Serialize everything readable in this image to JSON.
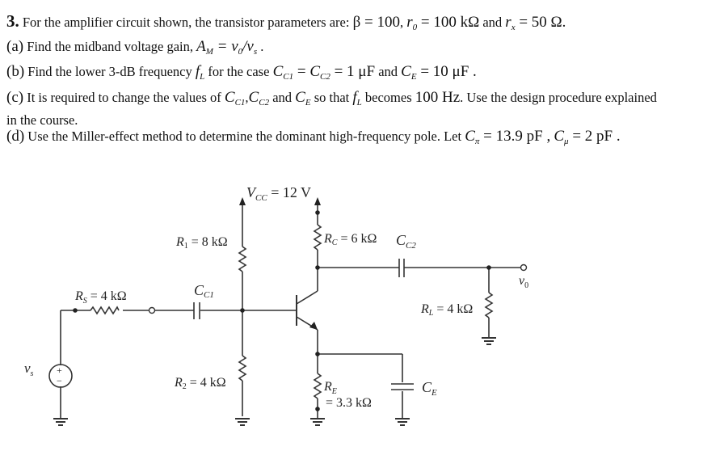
{
  "problem": {
    "number": "3.",
    "intro": "For the amplifier circuit shown, the transistor parameters are:",
    "params": {
      "beta": "β = 100",
      "ro_sym": "r",
      "ro_sub": "0",
      "ro_val": " = 100 kΩ",
      "and": "and",
      "rx_sym": "r",
      "rx_sub": "x",
      "rx_val": " = 50 Ω."
    },
    "parts": {
      "a": {
        "label": "(a)",
        "text": "Find the midband voltage gain,",
        "math_sym": "A",
        "math_sub": "M",
        "math_rest": " = v",
        "v0_sub": "0",
        "slash": "/v",
        "vs_sub": "s",
        "end": " ."
      },
      "b": {
        "label": "(b)",
        "text": "Find the lower 3-dB frequency",
        "fl_sym": "f",
        "fl_sub": "L",
        "text2": "for the case",
        "cc1_sym": "C",
        "cc1_sub": "C1",
        "eq": " = ",
        "cc2_sym": "C",
        "cc2_sub": "C2",
        "val": " = 1 μF",
        "and": "and",
        "ce_sym": "C",
        "ce_sub": "E",
        "ce_val": " = 10 μF ."
      },
      "c": {
        "label": "(c)",
        "text": "It is required to change the values of",
        "c1_sym": "C",
        "c1_sub": "C1",
        "comma": ",",
        "c2_sym": "C",
        "c2_sub": "C2",
        "and": "and",
        "ce_sym": "C",
        "ce_sub": "E",
        "text2": "so that",
        "fl_sym": "f",
        "fl_sub": "L",
        "text3": "becomes",
        "freq": "100 Hz",
        "text4": ". Use the design procedure explained",
        "cont": "in the course."
      },
      "d": {
        "label": "(d)",
        "text": "Use the Miller-effect method to determine the dominant high-frequency pole. Let",
        "cpi_sym": "C",
        "cpi_sub": "π",
        "cpi_val": " = 13.9 pF ,",
        "cmu_sym": "C",
        "cmu_sub": "μ",
        "cmu_val": " = 2  pF ."
      }
    }
  },
  "circuit": {
    "vcc": "V",
    "vcc_sub": "CC",
    "vcc_val": " = 12  V",
    "r1": "R",
    "r1_sub": "1",
    "r1_val": " = 8  kΩ",
    "rc": "R",
    "rc_sub": "C",
    "rc_val": " = 6  kΩ",
    "cc2": "C",
    "cc2_sub": "C2",
    "vo": "v",
    "vo_sub": "0",
    "rs": "R",
    "rs_sub": "S",
    "rs_val": " = 4  kΩ",
    "cc1": "C",
    "cc1_sub": "C1",
    "rl": "R",
    "rl_sub": "L",
    "rl_val": " = 4  kΩ",
    "vs": "v",
    "vs_sub": "s",
    "r2": "R",
    "r2_sub": "2",
    "r2_val": " = 4  kΩ",
    "re": "R",
    "re_sub": "E",
    "re_val": "= 3.3 kΩ",
    "ce": "C",
    "ce_sub": "E",
    "src_plus": "+",
    "src_minus": "−"
  }
}
